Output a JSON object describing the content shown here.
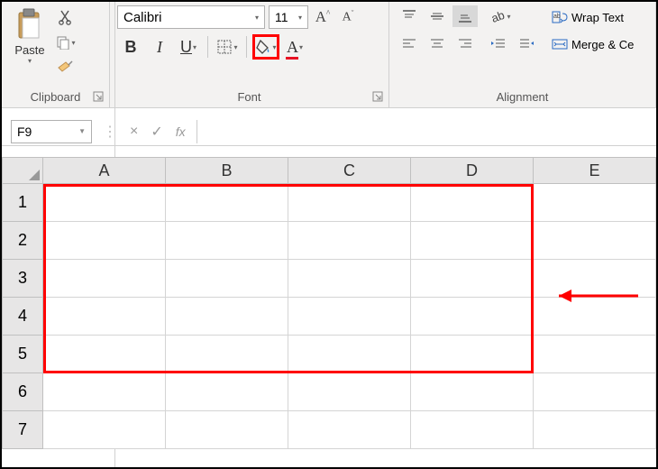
{
  "clipboard": {
    "label": "Clipboard",
    "paste": "Paste"
  },
  "font": {
    "label": "Font",
    "name": "Calibri",
    "size": "11",
    "bold": "B",
    "italic": "I",
    "underline": "U"
  },
  "alignment": {
    "label": "Alignment",
    "wrap": "Wrap Text",
    "merge": "Merge & Ce"
  },
  "namebox": {
    "value": "F9",
    "fx": "fx"
  },
  "columns": [
    "A",
    "B",
    "C",
    "D",
    "E"
  ],
  "rows": [
    "1",
    "2",
    "3",
    "4",
    "5",
    "6",
    "7"
  ]
}
